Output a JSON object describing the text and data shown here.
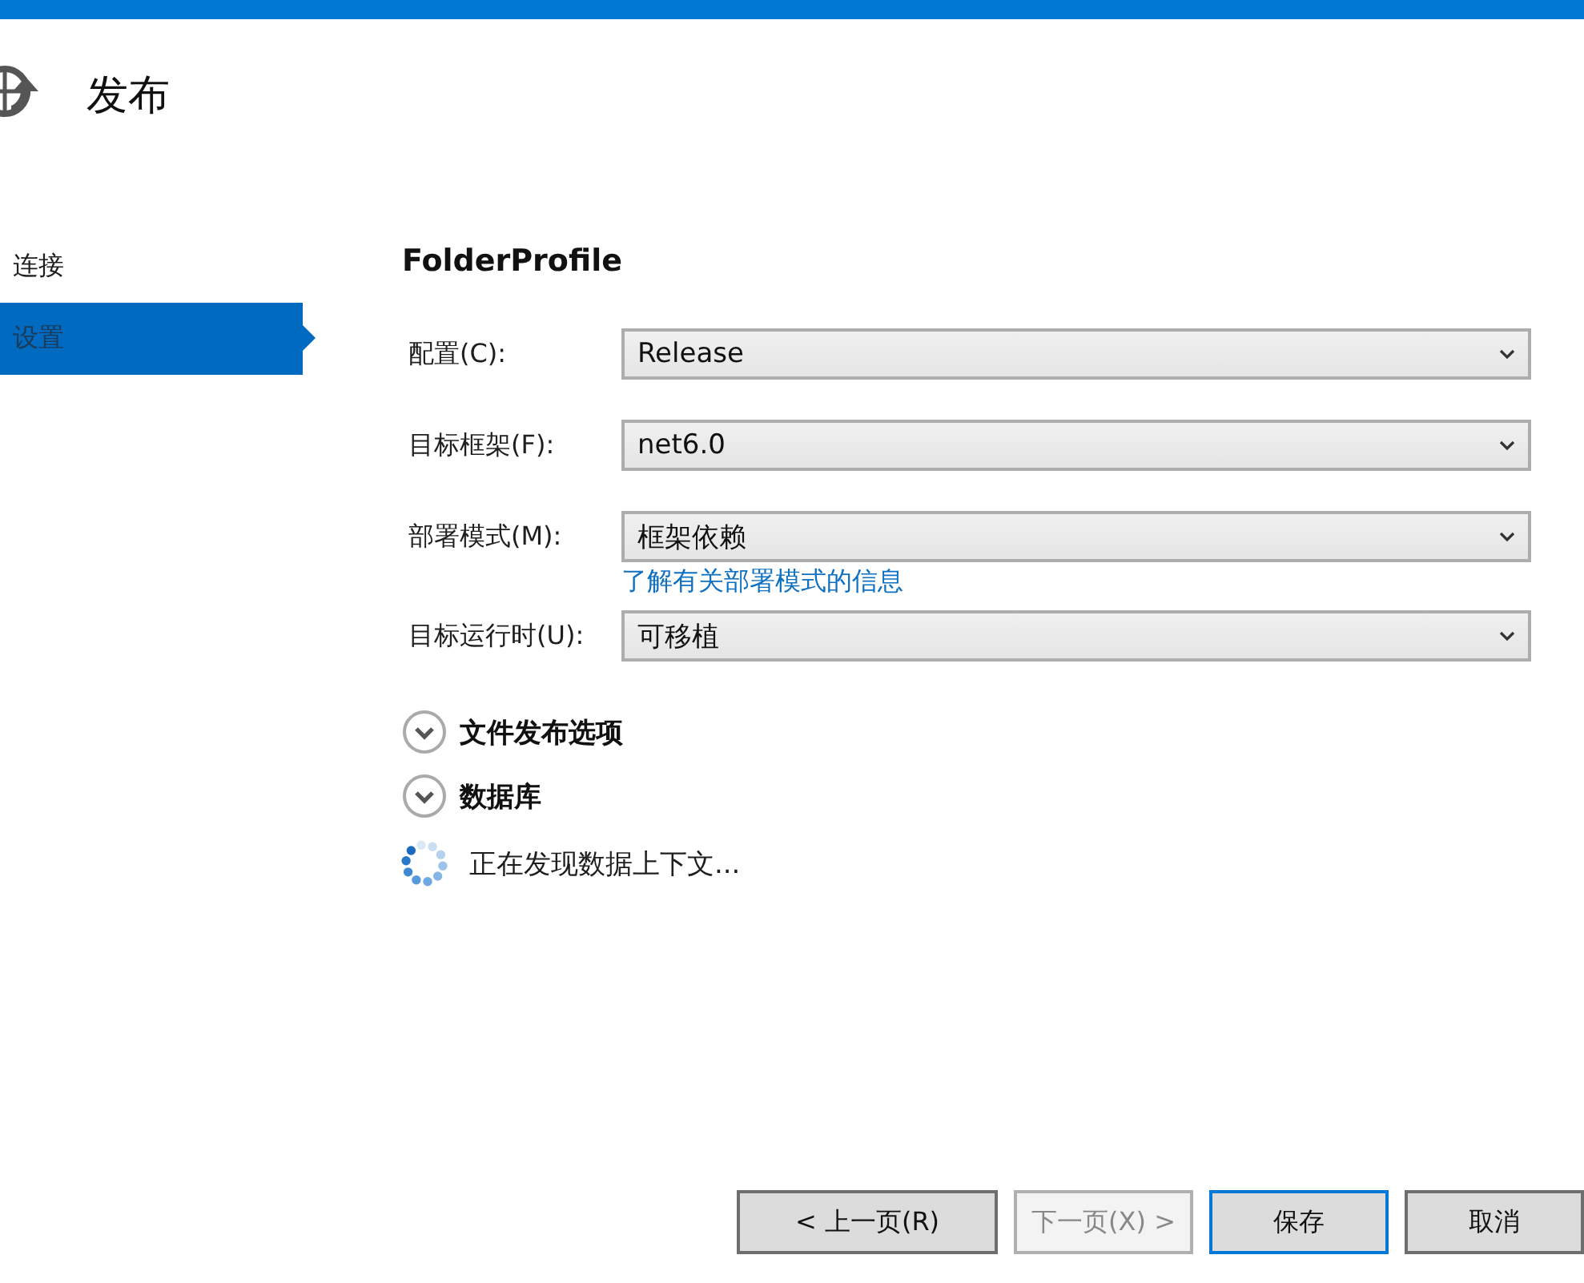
{
  "header": {
    "title": "发布"
  },
  "sidebar": {
    "items": [
      {
        "label": "连接",
        "selected": false
      },
      {
        "label": "设置",
        "selected": true
      }
    ]
  },
  "profile": {
    "name": "FolderProfile"
  },
  "fields": [
    {
      "label": "配置(C):",
      "value": "Release"
    },
    {
      "label": "目标框架(F):",
      "value": "net6.0"
    },
    {
      "label": "部署模式(M):",
      "value": "框架依赖",
      "link": "了解有关部署模式的信息"
    },
    {
      "label": "目标运行时(U):",
      "value": "可移植"
    }
  ],
  "sections": [
    {
      "title": "文件发布选项",
      "expanded": false
    },
    {
      "title": "数据库",
      "expanded": false
    }
  ],
  "status": {
    "text": "正在发现数据上下文..."
  },
  "buttons": [
    {
      "label": "< 上一页(R)",
      "disabled": false,
      "default": false
    },
    {
      "label": "下一页(X) >",
      "disabled": true,
      "default": false
    },
    {
      "label": "保存",
      "disabled": false,
      "default": true
    },
    {
      "label": "取消",
      "disabled": false,
      "default": false
    }
  ]
}
